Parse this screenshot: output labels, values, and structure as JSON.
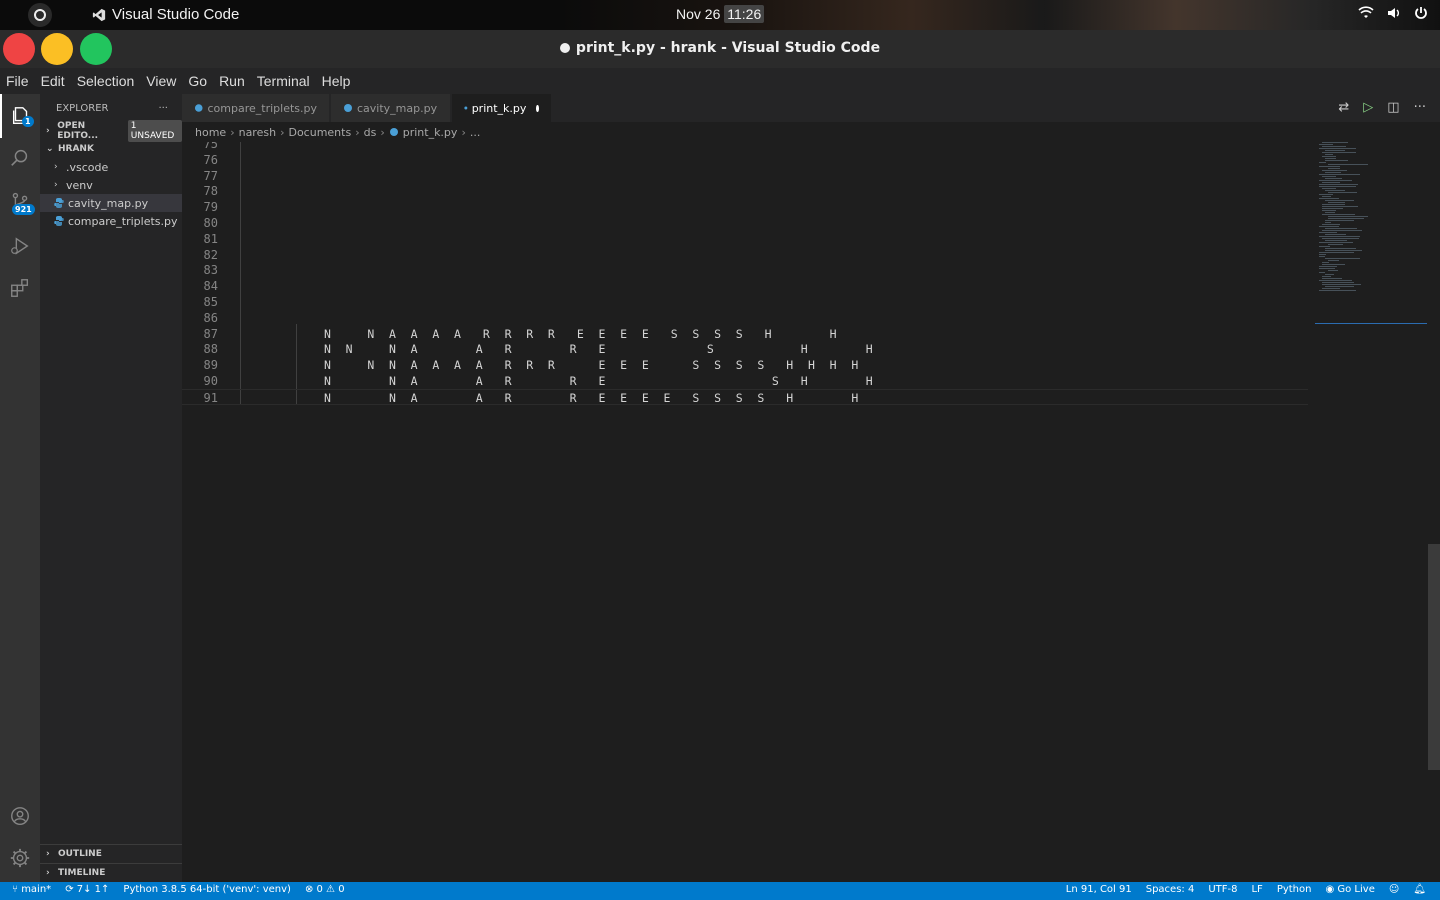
{
  "system": {
    "app_name": "Visual Studio Code",
    "date": "Nov 26",
    "time": "11:26"
  },
  "window": {
    "title": "print_k.py - hrank - Visual Studio Code"
  },
  "menu": [
    "File",
    "Edit",
    "Selection",
    "View",
    "Go",
    "Run",
    "Terminal",
    "Help"
  ],
  "activity_bar": {
    "explorer_badge": "1",
    "scm_badge": "921"
  },
  "sidebar": {
    "header": "EXPLORER",
    "more": "···",
    "open_editors": "OPEN EDITO...",
    "unsaved": "1 UNSAVED",
    "folder": "HRANK",
    "items": [
      {
        "label": ".vscode",
        "type": "folder"
      },
      {
        "label": "venv",
        "type": "folder"
      },
      {
        "label": "cavity_map.py",
        "type": "python"
      },
      {
        "label": "compare_triplets.py",
        "type": "python"
      }
    ],
    "outline": "OUTLINE",
    "timeline": "TIMELINE"
  },
  "tabs": [
    {
      "label": "compare_triplets.py"
    },
    {
      "label": "cavity_map.py"
    },
    {
      "label": "print_k.py",
      "active": true,
      "modified": true
    }
  ],
  "breadcrumb": [
    "home",
    "naresh",
    "Documents",
    "ds",
    "print_k.py",
    "..."
  ],
  "editor": {
    "lines": [
      {
        "n": "75",
        "text": ""
      },
      {
        "n": "76",
        "text": ""
      },
      {
        "n": "77",
        "text": ""
      },
      {
        "n": "78",
        "text": ""
      },
      {
        "n": "79",
        "text": ""
      },
      {
        "n": "80",
        "text": ""
      },
      {
        "n": "81",
        "text": ""
      },
      {
        "n": "82",
        "text": ""
      },
      {
        "n": "83",
        "text": ""
      },
      {
        "n": "84",
        "text": ""
      },
      {
        "n": "85",
        "text": ""
      },
      {
        "n": "86",
        "text": ""
      },
      {
        "n": "87",
        "text": "N     N  A  A  A  A   R  R  R  R   E  E  E  E   S  S  S  S   H        H"
      },
      {
        "n": "88",
        "text": "N  N     N  A        A   R        R   E              S            H        H"
      },
      {
        "n": "89",
        "text": "N     N  N  A  A  A  A   R  R  R      E  E  E      S  S  S  S   H  H  H  H"
      },
      {
        "n": "90",
        "text": "N        N  A        A   R        R   E                       S   H        H"
      },
      {
        "n": "91",
        "text": "N        N  A        A   R        R   E  E  E  E   S  S  S  S   H        H"
      }
    ]
  },
  "statusbar": {
    "branch": "main*",
    "sync": "7↓ 1↑",
    "interpreter": "Python 3.8.5 64-bit ('venv': venv)",
    "problems": "⊗ 0 ⚠ 0",
    "position": "Ln 91, Col 91",
    "spaces": "Spaces: 4",
    "encoding": "UTF-8",
    "eol": "LF",
    "language": "Python",
    "golive": "Go Live"
  }
}
